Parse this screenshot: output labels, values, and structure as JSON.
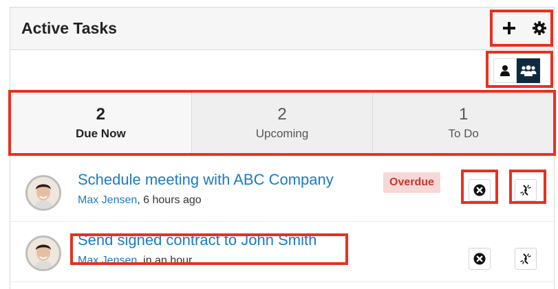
{
  "header": {
    "title": "Active Tasks",
    "add_icon": "plus-icon",
    "settings_icon": "gear-icon"
  },
  "toggles": {
    "mine_icon": "user-icon",
    "team_icon": "users-icon"
  },
  "tabs": [
    {
      "count": "2",
      "label": "Due Now"
    },
    {
      "count": "2",
      "label": "Upcoming"
    },
    {
      "count": "1",
      "label": "To Do"
    }
  ],
  "tasks": [
    {
      "title": "Schedule meeting with ABC Company",
      "assignee": "Max Jensen",
      "when": ", 6 hours ago",
      "badge": "Overdue"
    },
    {
      "title": "Send signed contract to John Smith",
      "assignee": "Max Jensen",
      "when": ", in an hour",
      "badge": ""
    }
  ],
  "colors": {
    "link": "#1a7ac4",
    "overdue_text": "#c0392b",
    "overdue_bg": "#f8d7d7",
    "team_toggle_bg": "#0f2a3f",
    "highlight": "#e8301e"
  }
}
